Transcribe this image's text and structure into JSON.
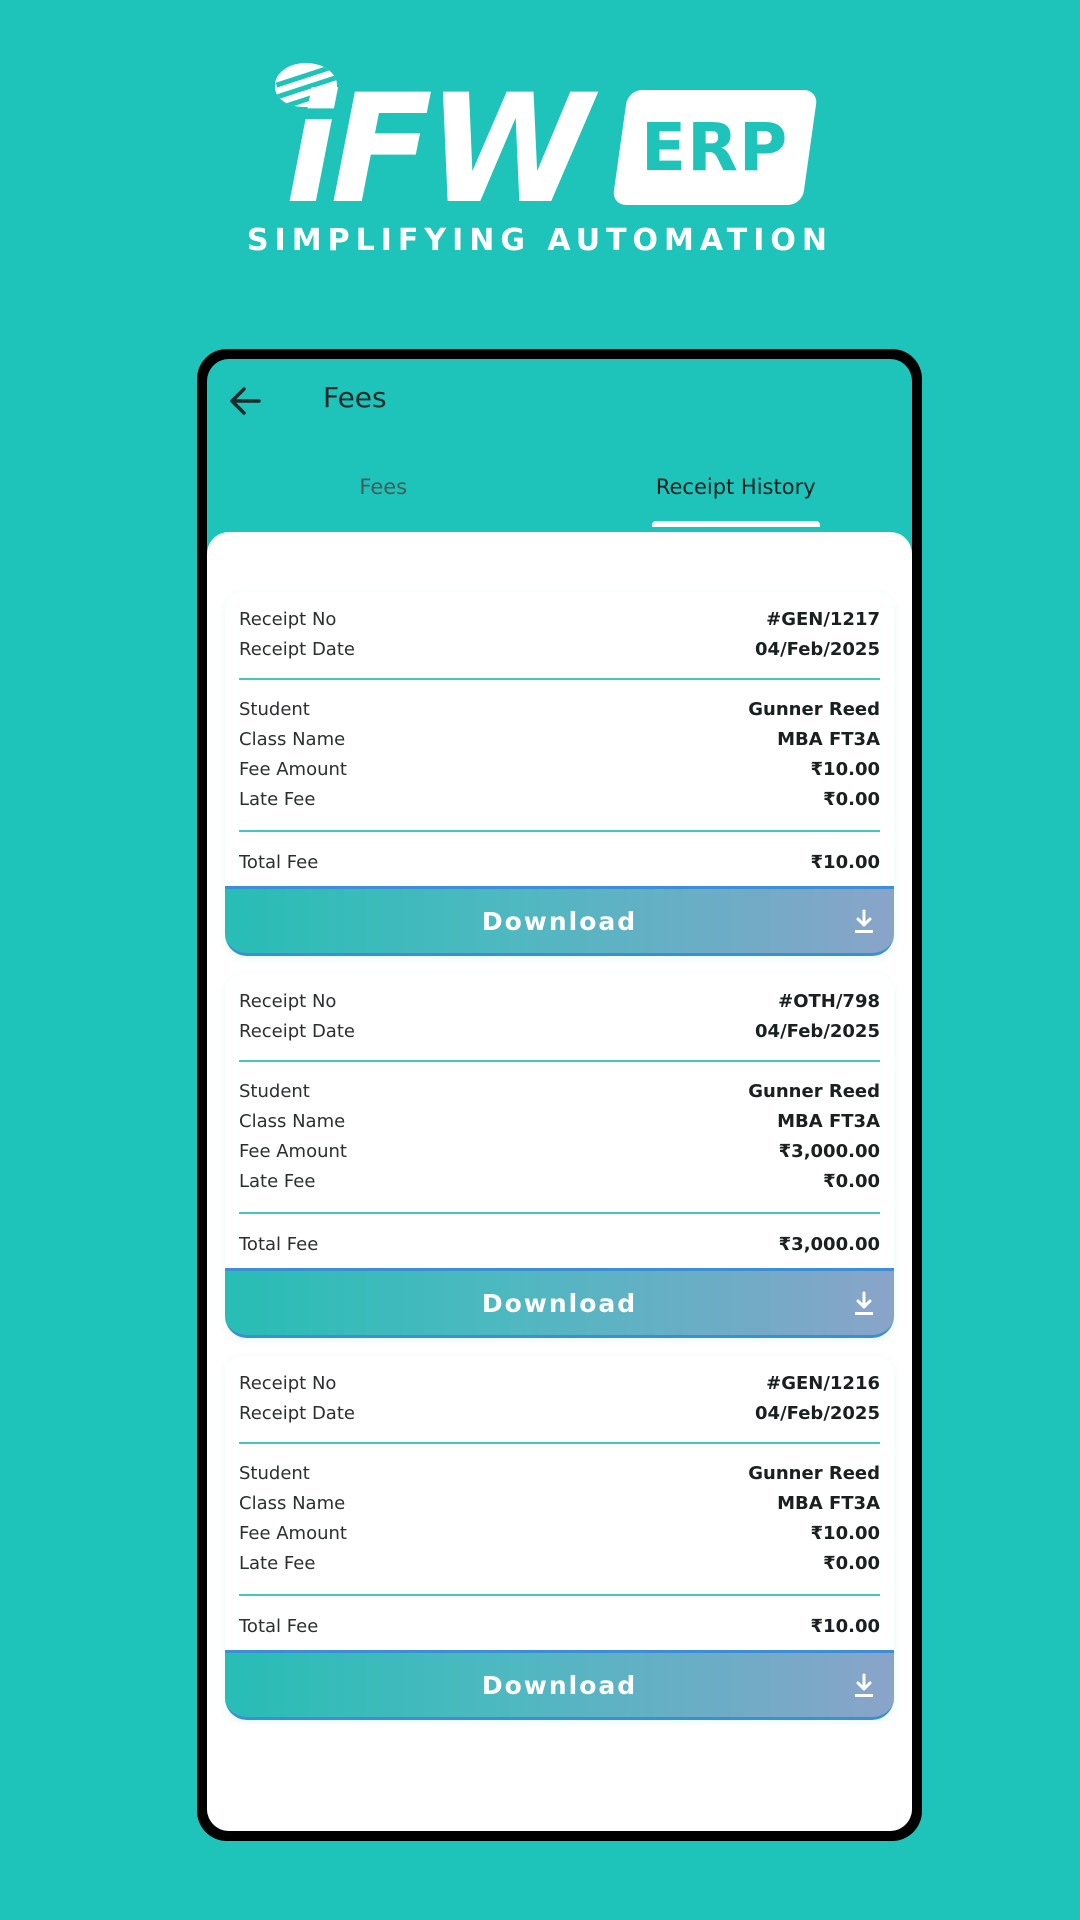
{
  "brand": {
    "logo_text": "iFW",
    "logo_badge": "ERP",
    "tagline": "SIMPLIFYING AUTOMATION"
  },
  "appbar": {
    "back_icon": "arrow-left-icon",
    "title": "Fees"
  },
  "tabs": [
    {
      "label": "Fees",
      "selected": false
    },
    {
      "label": "Receipt History",
      "selected": true
    }
  ],
  "colors": {
    "background": "#1ec3b9",
    "divider": "#45c6bd",
    "button_border": "#3c8fd6"
  },
  "receipts": [
    {
      "receipt_no_label": "Receipt No",
      "receipt_no": "#GEN/1217",
      "receipt_date_label": "Receipt Date",
      "receipt_date": "04/Feb/2025",
      "student_label": "Student",
      "student": "Gunner Reed",
      "class_label": "Class Name",
      "class_name": "MBA FT3A",
      "fee_amount_label": "Fee Amount",
      "fee_amount": "₹10.00",
      "late_fee_label": "Late Fee",
      "late_fee": "₹0.00",
      "total_fee_label": "Total Fee",
      "total_fee": "₹10.00",
      "download_label": "Download",
      "download_icon": "download-icon"
    },
    {
      "receipt_no_label": "Receipt No",
      "receipt_no": "#OTH/798",
      "receipt_date_label": "Receipt Date",
      "receipt_date": "04/Feb/2025",
      "student_label": "Student",
      "student": "Gunner Reed",
      "class_label": "Class Name",
      "class_name": "MBA FT3A",
      "fee_amount_label": "Fee Amount",
      "fee_amount": "₹3,000.00",
      "late_fee_label": "Late Fee",
      "late_fee": "₹0.00",
      "total_fee_label": "Total Fee",
      "total_fee": "₹3,000.00",
      "download_label": "Download",
      "download_icon": "download-icon"
    },
    {
      "receipt_no_label": "Receipt No",
      "receipt_no": "#GEN/1216",
      "receipt_date_label": "Receipt Date",
      "receipt_date": "04/Feb/2025",
      "student_label": "Student",
      "student": "Gunner Reed",
      "class_label": "Class Name",
      "class_name": "MBA FT3A",
      "fee_amount_label": "Fee Amount",
      "fee_amount": "₹10.00",
      "late_fee_label": "Late Fee",
      "late_fee": "₹0.00",
      "total_fee_label": "Total Fee",
      "total_fee": "₹10.00",
      "download_label": "Download",
      "download_icon": "download-icon"
    }
  ]
}
